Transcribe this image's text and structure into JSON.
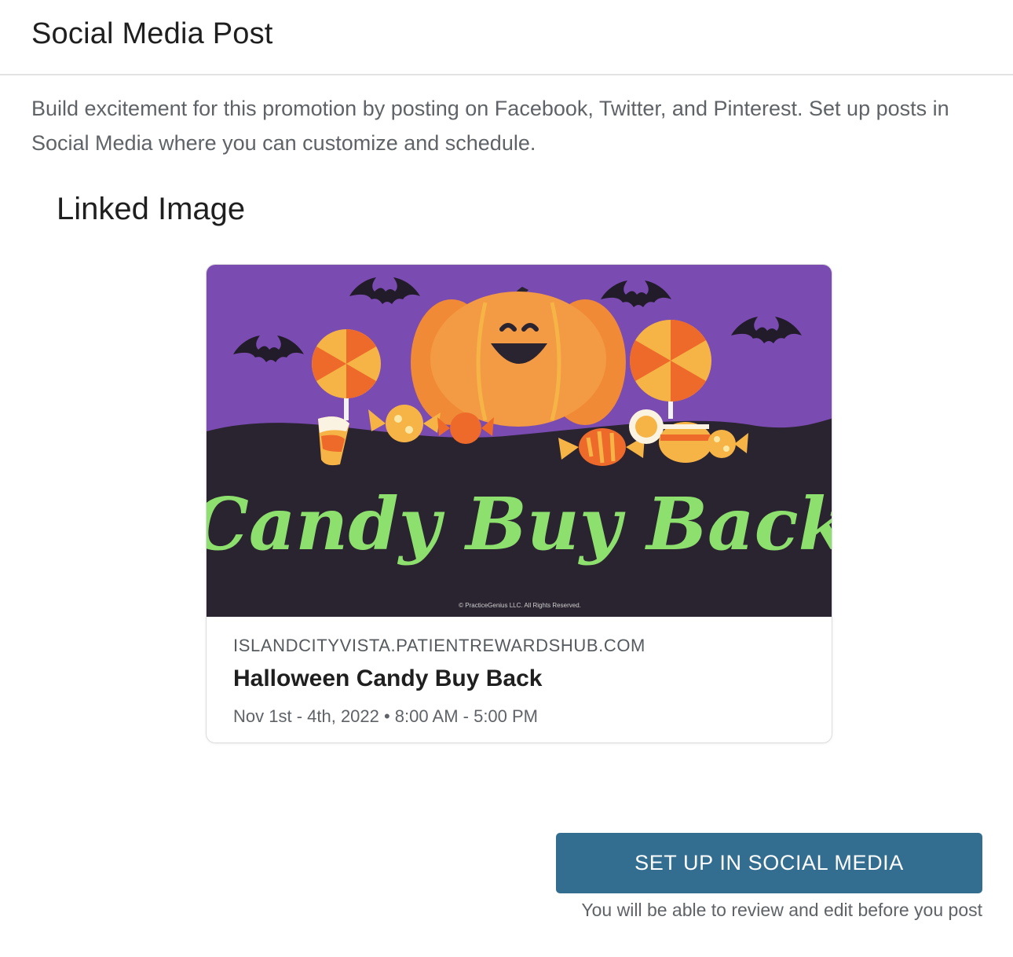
{
  "header": {
    "title": "Social Media Post"
  },
  "description": "Build excitement for this promotion by posting on Facebook, Twitter, and Pinterest. Set up posts in Social Media where you can customize and schedule.",
  "linked_image": {
    "section_title": "Linked Image",
    "image_headline": "Candy Buy Back",
    "image_copyright": "© PracticeGenius LLC. All Rights Reserved.",
    "domain": "ISLANDCITYVISTA.PATIENTREWARDSHUB.COM",
    "title": "Halloween Candy Buy Back",
    "date": "Nov 1st - 4th, 2022 • 8:00 AM - 5:00 PM"
  },
  "actions": {
    "setup_label": "SET UP IN SOCIAL MEDIA",
    "note": "You will be able to review and edit before you post"
  },
  "colors": {
    "button": "#336e91",
    "image_purple": "#7a4bb0",
    "image_dark": "#2a2330",
    "image_green": "#8de06e",
    "pumpkin": "#f08a36"
  },
  "icons": [
    "bat-icon",
    "pumpkin-icon",
    "lollipop-icon",
    "candy-icon",
    "candy-corn-icon"
  ]
}
